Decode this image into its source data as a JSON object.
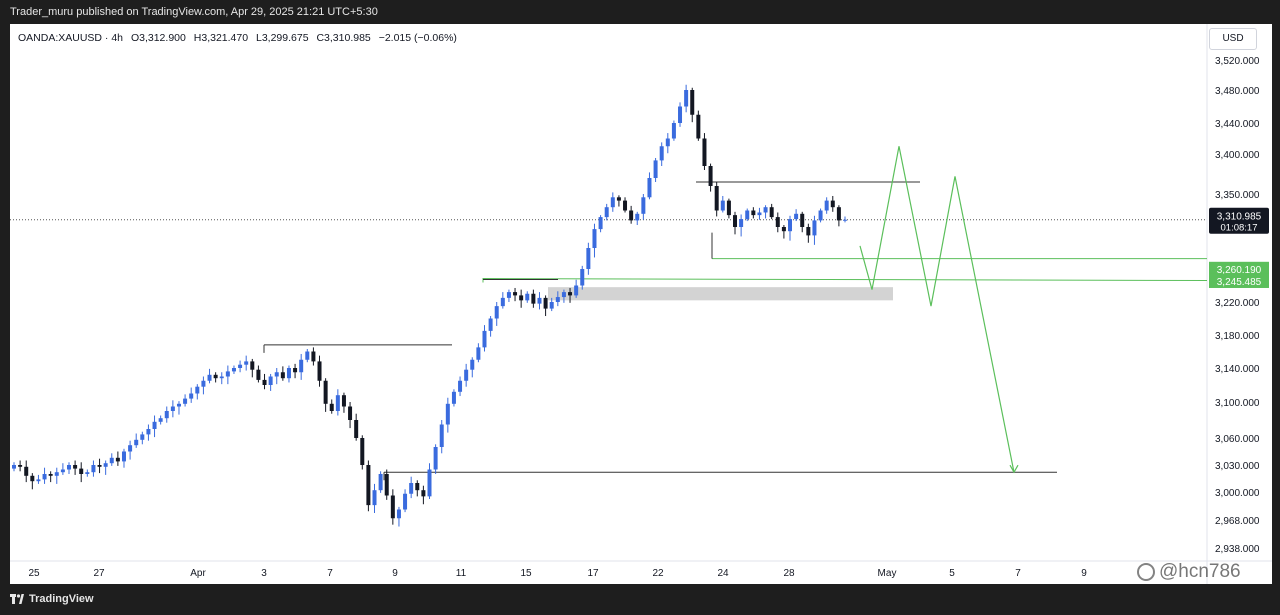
{
  "header": {
    "publish_line": "Trader_muru published on TradingView.com, Apr 29, 2025 21:21 UTC+5:30"
  },
  "symbol_bar": {
    "symbol": "OANDA:XAUUSD · 4h",
    "open": "O3,312.900",
    "high": "H3,321.470",
    "low": "L3,299.675",
    "close": "C3,310.985",
    "change": "−2.015 (−0.06%)"
  },
  "currency": "USD",
  "footer": {
    "brand": "TradingView"
  },
  "watermark": "@hcn786",
  "colors": {
    "bull": "#3a6bde",
    "bear": "#131722",
    "projection": "#5bbf5b",
    "zone": "#d3d3d3",
    "lines": "#333333"
  },
  "chart_data": {
    "type": "candlestick",
    "symbol": "OANDA:XAUUSD",
    "timeframe": "4h",
    "y_ticks": [
      3520,
      3480,
      3440,
      3400,
      3350,
      3300,
      3260,
      3220,
      3180,
      3140,
      3100,
      3060,
      3030,
      3000,
      2968,
      2938
    ],
    "y_tick_labels": [
      "3,520.000",
      "3,480.000",
      "3,440.000",
      "3,400.000",
      "3,350.000",
      "3,300.000",
      "3,260.000",
      "3,220.000",
      "3,180.000",
      "3,140.000",
      "3,100.000",
      "3,060.000",
      "3,030.000",
      "3,000.000",
      "2,968.000",
      "2,938.000"
    ],
    "x_tick_labels": [
      "25",
      "27",
      "Apr",
      "3",
      "7",
      "9",
      "11",
      "15",
      "17",
      "22",
      "24",
      "28",
      "May",
      "5",
      "7",
      "9"
    ],
    "price_badges": [
      {
        "label": "3,310.985",
        "sub": "01:08:17",
        "value": 3310.985,
        "style": "dark"
      },
      {
        "label": "3,260.190",
        "value": 3260.19,
        "style": "green"
      },
      {
        "label": "3,245.485",
        "value": 3245.485,
        "style": "green"
      }
    ],
    "current_price": 3310.985,
    "candles_close": [
      3030,
      3028,
      3018,
      3012,
      3014,
      3020,
      3018,
      3022,
      3025,
      3030,
      3026,
      3020,
      3022,
      3030,
      3028,
      3032,
      3038,
      3034,
      3045,
      3052,
      3058,
      3064,
      3070,
      3078,
      3082,
      3090,
      3095,
      3098,
      3104,
      3110,
      3118,
      3125,
      3132,
      3128,
      3130,
      3136,
      3140,
      3144,
      3148,
      3138,
      3126,
      3120,
      3130,
      3135,
      3128,
      3140,
      3135,
      3150,
      3160,
      3148,
      3125,
      3098,
      3090,
      3108,
      3095,
      3080,
      3060,
      3030,
      2985,
      3002,
      3020,
      2996,
      2970,
      2980,
      2998,
      3010,
      3002,
      2995,
      3025,
      3050,
      3075,
      3098,
      3112,
      3125,
      3138,
      3150,
      3165,
      3185,
      3200,
      3215,
      3225,
      3232,
      3228,
      3222,
      3230,
      3218,
      3225,
      3212,
      3220,
      3226,
      3232,
      3228,
      3240,
      3260,
      3280,
      3298,
      3315,
      3330,
      3345,
      3340,
      3325,
      3310,
      3320,
      3345,
      3370,
      3392,
      3410,
      3420,
      3440,
      3460,
      3480,
      3450,
      3420,
      3385,
      3360,
      3325,
      3340,
      3318,
      3300,
      3312,
      3325,
      3318,
      3322,
      3330,
      3315,
      3300,
      3296,
      3312,
      3320,
      3300,
      3292,
      3310,
      3325,
      3340,
      3330,
      3310,
      3311
    ],
    "annotations": {
      "resistance_box_top": 3365,
      "range_low": 3268,
      "demand_zone": [
        3222,
        3238
      ],
      "breakout_level_1": 3246,
      "breakout_level_2": 3168,
      "target_level": 3022,
      "projection_path_prices": [
        3282,
        3235,
        3410,
        3215,
        3372,
        3022
      ]
    }
  }
}
